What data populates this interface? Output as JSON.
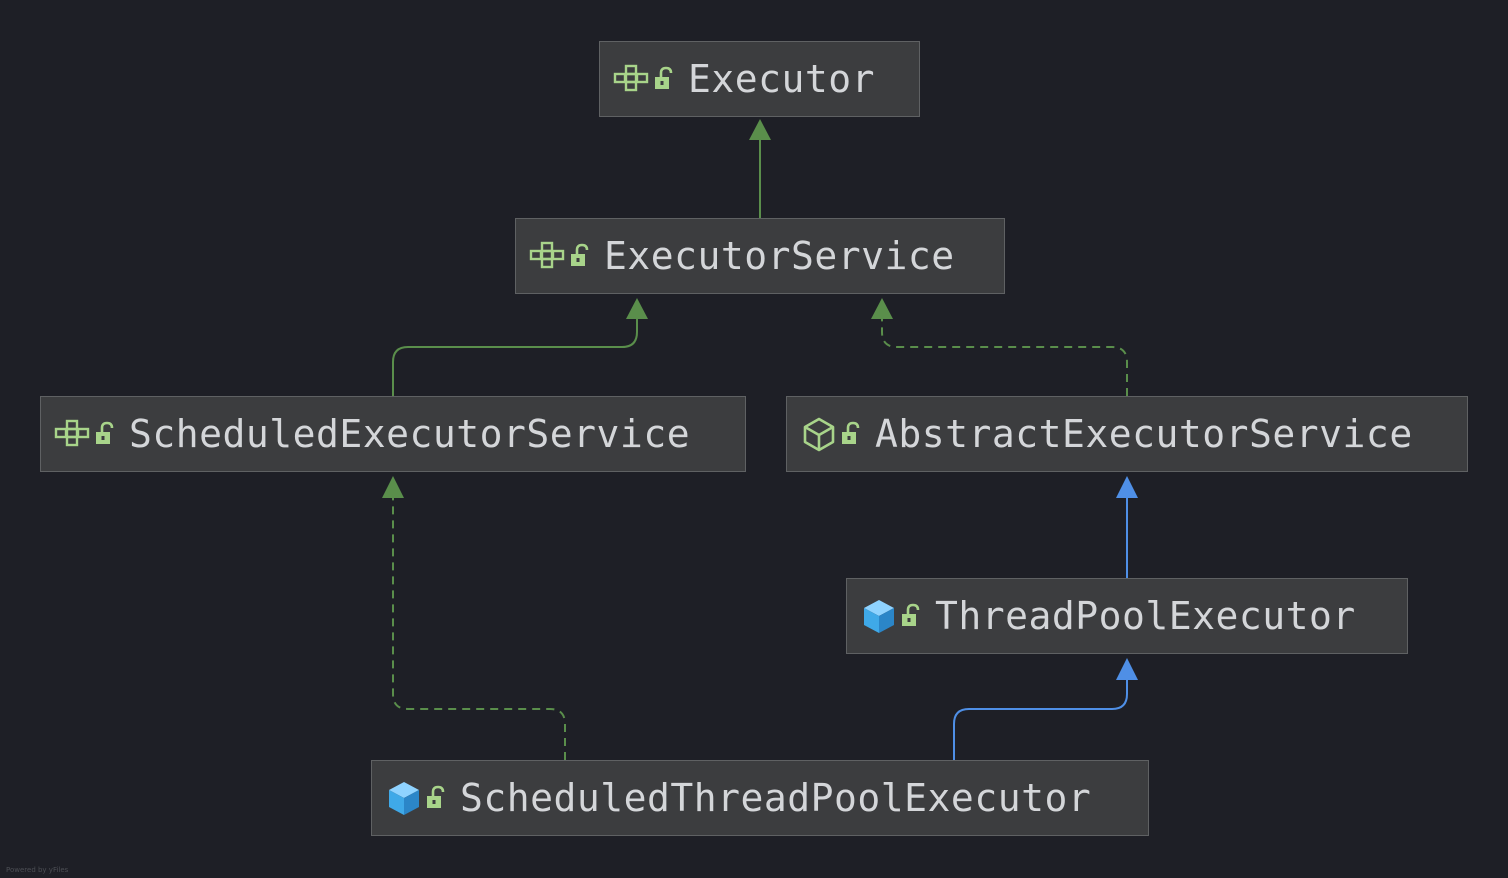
{
  "nodes": [
    {
      "id": "executor",
      "label": "Executor",
      "kind": "interface",
      "icon": "interface-icon"
    },
    {
      "id": "executor-service",
      "label": "ExecutorService",
      "kind": "interface",
      "icon": "interface-icon"
    },
    {
      "id": "scheduled-executor-service",
      "label": "ScheduledExecutorService",
      "kind": "interface",
      "icon": "interface-icon"
    },
    {
      "id": "abstract-executor-service",
      "label": "AbstractExecutorService",
      "kind": "abstract-class",
      "icon": "abstract-class-icon"
    },
    {
      "id": "thread-pool-executor",
      "label": "ThreadPoolExecutor",
      "kind": "class",
      "icon": "class-icon"
    },
    {
      "id": "scheduled-thread-pool-executor",
      "label": "ScheduledThreadPoolExecutor",
      "kind": "class",
      "icon": "class-icon"
    }
  ],
  "edges": [
    {
      "from": "executor-service",
      "to": "executor",
      "type": "interface-extends"
    },
    {
      "from": "scheduled-executor-service",
      "to": "executor-service",
      "type": "interface-extends"
    },
    {
      "from": "abstract-executor-service",
      "to": "executor-service",
      "type": "implements"
    },
    {
      "from": "thread-pool-executor",
      "to": "abstract-executor-service",
      "type": "extends"
    },
    {
      "from": "scheduled-thread-pool-executor",
      "to": "thread-pool-executor",
      "type": "extends"
    },
    {
      "from": "scheduled-thread-pool-executor",
      "to": "scheduled-executor-service",
      "type": "implements"
    }
  ],
  "colors": {
    "background": "#1e1f26",
    "node_fill": "#3c3d3f",
    "node_border": "#5f6163",
    "text": "#d4d6d9",
    "interface_edge": "#5a8e4b",
    "class_edge": "#4f8fe6",
    "icon_green": "#a8d48a",
    "icon_blue": "#3fa9e8"
  },
  "footer": "Powered by yFiles"
}
